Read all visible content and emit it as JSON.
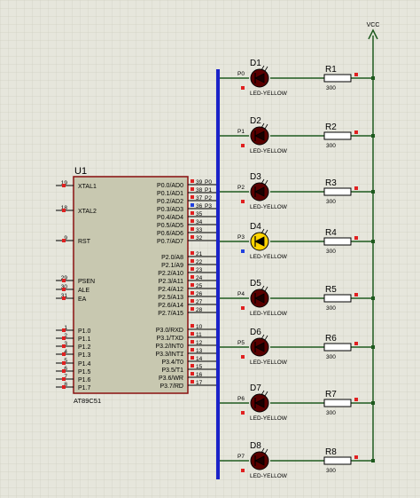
{
  "colors": {
    "background": "#e6e6dc",
    "grid": "#cfcfc2",
    "wire": "#1e5a1e",
    "bus": "#1a22c8",
    "chip_fill": "#c8c8b0",
    "chip_border": "#8a1010",
    "led_off": "#5a0000",
    "led_on": "#ffd400",
    "pin_high": "#e02020",
    "pin_low": "#2040e0",
    "text": "#000000"
  },
  "mcu": {
    "ref": "U1",
    "part": "AT89C51",
    "left_pins": [
      {
        "num": "19",
        "name": "XTAL1"
      },
      {
        "num": "18",
        "name": "XTAL2"
      },
      {
        "num": "9",
        "name": "RST"
      },
      {
        "num": "29",
        "name": "PSEN"
      },
      {
        "num": "30",
        "name": "ALE"
      },
      {
        "num": "31",
        "name": "EA"
      },
      {
        "num": "1",
        "name": "P1.0"
      },
      {
        "num": "2",
        "name": "P1.1"
      },
      {
        "num": "3",
        "name": "P1.2"
      },
      {
        "num": "4",
        "name": "P1.3"
      },
      {
        "num": "5",
        "name": "P1.4"
      },
      {
        "num": "6",
        "name": "P1.5"
      },
      {
        "num": "7",
        "name": "P1.6"
      },
      {
        "num": "8",
        "name": "P1.7"
      }
    ],
    "right_pins": [
      {
        "num": "39",
        "name": "P0.0/AD0",
        "net": "P0"
      },
      {
        "num": "38",
        "name": "P0.1/AD1",
        "net": "P1"
      },
      {
        "num": "37",
        "name": "P0.2/AD2",
        "net": "P2"
      },
      {
        "num": "36",
        "name": "P0.3/AD3",
        "net": "P3"
      },
      {
        "num": "35",
        "name": "P0.4/AD4",
        "net": ""
      },
      {
        "num": "34",
        "name": "P0.5/AD5",
        "net": ""
      },
      {
        "num": "33",
        "name": "P0.6/AD6",
        "net": ""
      },
      {
        "num": "32",
        "name": "P0.7/AD7",
        "net": ""
      },
      {
        "num": "21",
        "name": "P2.0/A8",
        "net": ""
      },
      {
        "num": "22",
        "name": "P2.1/A9",
        "net": ""
      },
      {
        "num": "23",
        "name": "P2.2/A10",
        "net": ""
      },
      {
        "num": "24",
        "name": "P2.3/A11",
        "net": ""
      },
      {
        "num": "25",
        "name": "P2.4/A12",
        "net": ""
      },
      {
        "num": "26",
        "name": "P2.5/A13",
        "net": ""
      },
      {
        "num": "27",
        "name": "P2.6/A14",
        "net": ""
      },
      {
        "num": "28",
        "name": "P2.7/A15",
        "net": ""
      },
      {
        "num": "10",
        "name": "P3.0/RXD",
        "net": ""
      },
      {
        "num": "11",
        "name": "P3.1/TXD",
        "net": ""
      },
      {
        "num": "12",
        "name": "P3.2/INT0",
        "net": ""
      },
      {
        "num": "13",
        "name": "P3.3/INT1",
        "net": ""
      },
      {
        "num": "14",
        "name": "P3.4/T0",
        "net": ""
      },
      {
        "num": "15",
        "name": "P3.5/T1",
        "net": ""
      },
      {
        "num": "16",
        "name": "P3.6/WR",
        "net": ""
      },
      {
        "num": "17",
        "name": "P3.7/RD",
        "net": ""
      }
    ]
  },
  "power": {
    "label": "VCC"
  },
  "channels": [
    {
      "net": "P0",
      "led": "D1",
      "led_type": "LED-YELLOW",
      "resistor": "R1",
      "value": "300",
      "lit": false
    },
    {
      "net": "P1",
      "led": "D2",
      "led_type": "LED-YELLOW",
      "resistor": "R2",
      "value": "300",
      "lit": false
    },
    {
      "net": "P2",
      "led": "D3",
      "led_type": "LED-YELLOW",
      "resistor": "R3",
      "value": "300",
      "lit": false
    },
    {
      "net": "P3",
      "led": "D4",
      "led_type": "LED-YELLOW",
      "resistor": "R4",
      "value": "300",
      "lit": true
    },
    {
      "net": "P4",
      "led": "D5",
      "led_type": "LED-YELLOW",
      "resistor": "R5",
      "value": "300",
      "lit": false
    },
    {
      "net": "P5",
      "led": "D6",
      "led_type": "LED-YELLOW",
      "resistor": "R6",
      "value": "300",
      "lit": false
    },
    {
      "net": "P6",
      "led": "D7",
      "led_type": "LED-YELLOW",
      "resistor": "R7",
      "value": "300",
      "lit": false
    },
    {
      "net": "P7",
      "led": "D8",
      "led_type": "LED-YELLOW",
      "resistor": "R8",
      "value": "300",
      "lit": false
    }
  ]
}
